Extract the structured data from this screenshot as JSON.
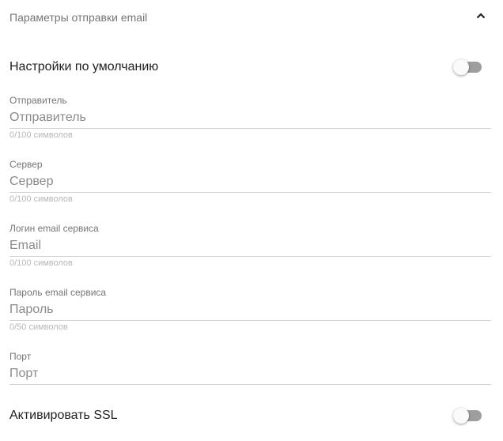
{
  "section": {
    "title": "Параметры отправки email",
    "expanded": true
  },
  "default_settings": {
    "label": "Настройки по умолчанию",
    "on": false
  },
  "fields": [
    {
      "label": "Отправитель",
      "value": "",
      "placeholder": "Отправитель",
      "hint": "0/100 символов"
    },
    {
      "label": "Сервер",
      "value": "",
      "placeholder": "Сервер",
      "hint": "0/100 символов"
    },
    {
      "label": "Логин email сервиса",
      "value": "",
      "placeholder": "Email",
      "hint": "0/100 символов"
    },
    {
      "label": "Пароль email сервиса",
      "value": "",
      "placeholder": "Пароль",
      "hint": "0/50 символов"
    },
    {
      "label": "Порт",
      "value": "",
      "placeholder": "Порт"
    }
  ],
  "ssl": {
    "label": "Активировать SSL",
    "on": false
  }
}
